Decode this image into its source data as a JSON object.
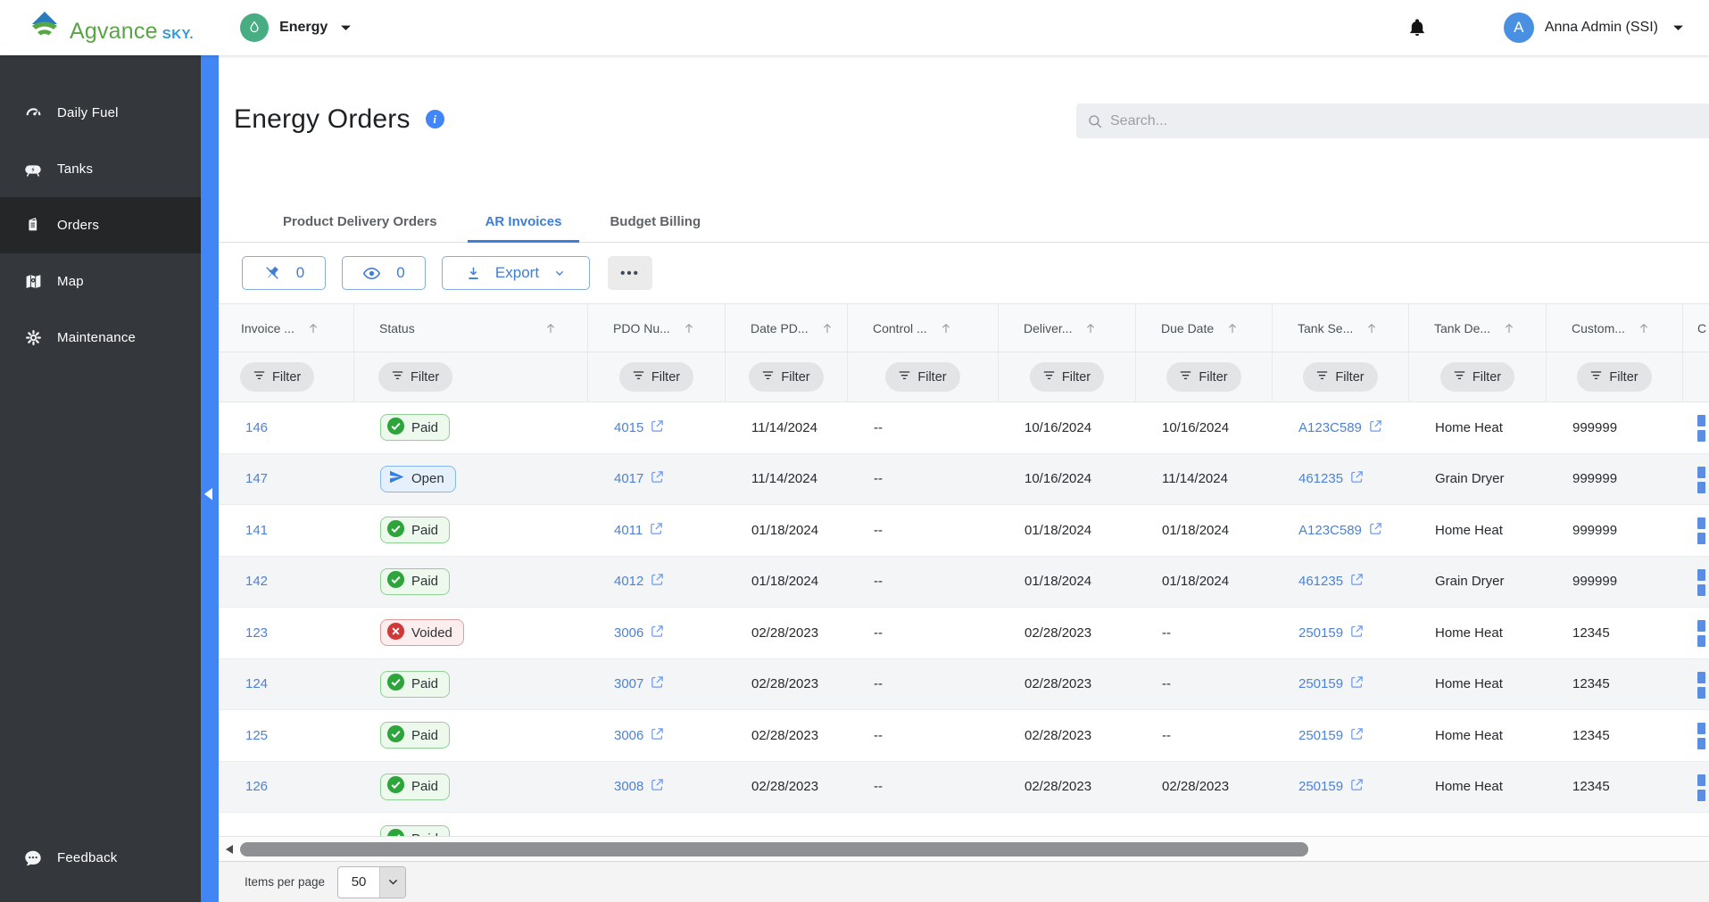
{
  "header": {
    "logo": {
      "brand": "Agvance",
      "suffix": "SKY."
    },
    "product": {
      "label": "Energy"
    },
    "user": {
      "initial": "A",
      "name": "Anna Admin (SSI)"
    }
  },
  "sidebar": {
    "items": [
      {
        "label": "Daily Fuel",
        "icon": "gauge-icon",
        "active": false
      },
      {
        "label": "Tanks",
        "icon": "tank-icon",
        "active": false
      },
      {
        "label": "Orders",
        "icon": "orders-icon",
        "active": true
      },
      {
        "label": "Map",
        "icon": "map-icon",
        "active": false
      },
      {
        "label": "Maintenance",
        "icon": "gear-icon",
        "active": false
      }
    ],
    "footer_item": {
      "label": "Feedback",
      "icon": "feedback-icon"
    }
  },
  "page": {
    "title": "Energy Orders",
    "search_placeholder": "Search...",
    "tabs": [
      {
        "label": "Product Delivery Orders",
        "active": false
      },
      {
        "label": "AR Invoices",
        "active": true
      },
      {
        "label": "Budget Billing",
        "active": false
      }
    ],
    "toolbar": {
      "pin_count": "0",
      "visibility_count": "0",
      "export_label": "Export",
      "more_label": "•••"
    }
  },
  "table": {
    "columns": [
      "Invoice ...",
      "Status",
      "PDO Nu...",
      "Date PD...",
      "Control ...",
      "Deliver...",
      "Due Date",
      "Tank Se...",
      "Tank De...",
      "Custom..."
    ],
    "partial_column_label": "C",
    "filter_label": "Filter",
    "rows": [
      {
        "invoice": "146",
        "status": "Paid",
        "pdo": "4015",
        "date_pd": "11/14/2024",
        "control": "--",
        "delivery": "10/16/2024",
        "due": "10/16/2024",
        "tank_serial": "A123C589",
        "tank_desc": "Home Heat",
        "customer": "999999"
      },
      {
        "invoice": "147",
        "status": "Open",
        "pdo": "4017",
        "date_pd": "11/14/2024",
        "control": "--",
        "delivery": "10/16/2024",
        "due": "11/14/2024",
        "tank_serial": "461235",
        "tank_desc": "Grain Dryer",
        "customer": "999999"
      },
      {
        "invoice": "141",
        "status": "Paid",
        "pdo": "4011",
        "date_pd": "01/18/2024",
        "control": "--",
        "delivery": "01/18/2024",
        "due": "01/18/2024",
        "tank_serial": "A123C589",
        "tank_desc": "Home Heat",
        "customer": "999999"
      },
      {
        "invoice": "142",
        "status": "Paid",
        "pdo": "4012",
        "date_pd": "01/18/2024",
        "control": "--",
        "delivery": "01/18/2024",
        "due": "01/18/2024",
        "tank_serial": "461235",
        "tank_desc": "Grain Dryer",
        "customer": "999999"
      },
      {
        "invoice": "123",
        "status": "Voided",
        "pdo": "3006",
        "date_pd": "02/28/2023",
        "control": "--",
        "delivery": "02/28/2023",
        "due": "--",
        "tank_serial": "250159",
        "tank_desc": "Home Heat",
        "customer": "12345"
      },
      {
        "invoice": "124",
        "status": "Paid",
        "pdo": "3007",
        "date_pd": "02/28/2023",
        "control": "--",
        "delivery": "02/28/2023",
        "due": "--",
        "tank_serial": "250159",
        "tank_desc": "Home Heat",
        "customer": "12345"
      },
      {
        "invoice": "125",
        "status": "Paid",
        "pdo": "3006",
        "date_pd": "02/28/2023",
        "control": "--",
        "delivery": "02/28/2023",
        "due": "--",
        "tank_serial": "250159",
        "tank_desc": "Home Heat",
        "customer": "12345"
      },
      {
        "invoice": "126",
        "status": "Paid",
        "pdo": "3008",
        "date_pd": "02/28/2023",
        "control": "--",
        "delivery": "02/28/2023",
        "due": "02/28/2023",
        "tank_serial": "250159",
        "tank_desc": "Home Heat",
        "customer": "12345"
      }
    ],
    "partial_row_status": "Paid"
  },
  "pagination": {
    "items_per_page_label": "Items per page",
    "items_per_page_value": "50"
  },
  "colors": {
    "accent_blue": "#4285f4",
    "link_blue": "#4d82d6",
    "tab_active_blue": "#3d7edc",
    "paid_green": "#2ea53c",
    "open_blue": "#2e7ee5",
    "voided_red": "#ce3a3a",
    "sidebar_dark": "#34373b"
  }
}
